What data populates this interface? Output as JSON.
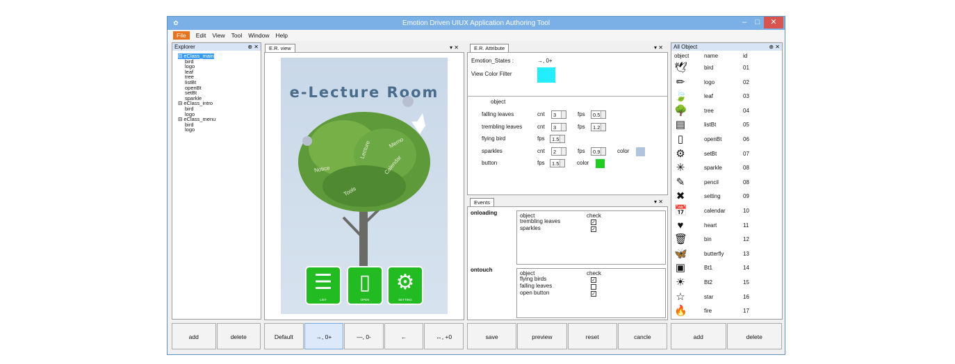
{
  "window": {
    "title": "Emotion Driven UIUX Application Authoring Tool",
    "min": "–",
    "max": "□",
    "close": "✕"
  },
  "menu": [
    "File",
    "Edit",
    "View",
    "Tool",
    "Window",
    "Help"
  ],
  "explorer": {
    "title": "Explorer",
    "pin": "⊕ ✕",
    "tree": [
      "⊟ eClass_main",
      "bird",
      "logo",
      "leaf",
      "tree",
      "listBt",
      "openBt",
      "setBt",
      "sparkle",
      "⊟ eClass_intro",
      "bird",
      "logo",
      "⊟ eClass_menu",
      "bird",
      "logo"
    ],
    "add": "add",
    "delete": "delete"
  },
  "erview": {
    "tab": "E.R. view",
    "ctrl": "▾ ✕",
    "title": "e-Lecture Room",
    "branches": [
      "Notice",
      "Tools",
      "Lecture",
      "Calendar",
      "Memo"
    ],
    "icons": [
      "LIST",
      "OPEN",
      "SETTING"
    ]
  },
  "erbuttons": [
    "Default",
    "→, 0+",
    "—, 0-",
    "←",
    "↔, +0"
  ],
  "attr": {
    "tab": "E.R. Attribute",
    "ctrl": "▾ ✕",
    "emotion_label": "Emotion_States :",
    "emotion_value": "→, 0+",
    "filter_label": "View Color Filter",
    "filter_color": "#22eeff",
    "object_header": "object",
    "rows": [
      {
        "name": "falling leaves",
        "a": "cnt",
        "av": "3",
        "b": "fps",
        "bv": "0.5"
      },
      {
        "name": "trembling leaves",
        "a": "cnt",
        "av": "3",
        "b": "fps",
        "bv": "1.2"
      },
      {
        "name": "flying bird",
        "a": "fps",
        "av": "1.5"
      },
      {
        "name": "sparkles",
        "a": "cnt",
        "av": "2",
        "b": "fps",
        "bv": "0.9",
        "c": "color",
        "color": "#b0c4de"
      },
      {
        "name": "button",
        "a": "fps",
        "av": "1.5",
        "c": "color",
        "color": "#22cc22"
      }
    ]
  },
  "events": {
    "tab": "Events",
    "ctrl": "▾ ✕",
    "onloading": "onloading",
    "ontouch": "ontouch",
    "col_object": "object",
    "col_check": "check",
    "load_items": [
      "trembling leaves",
      "sparkles"
    ],
    "touch_items": [
      "flying birds",
      "falling leaves",
      "open button"
    ],
    "touch_checked": [
      true,
      false,
      true
    ]
  },
  "actions": [
    "save",
    "preview",
    "reset",
    "cancle"
  ],
  "allobject": {
    "title": "All Object",
    "pin": "⊕ ✕",
    "headers": [
      "object",
      "name",
      "id"
    ],
    "items": [
      {
        "icon": "🕊",
        "name": "bird",
        "id": "01"
      },
      {
        "icon": "✏",
        "name": "logo",
        "id": "02"
      },
      {
        "icon": "🍃",
        "name": "leaf",
        "id": "03"
      },
      {
        "icon": "🌳",
        "name": "tree",
        "id": "04"
      },
      {
        "icon": "▤",
        "name": "listBt",
        "id": "05"
      },
      {
        "icon": "▯",
        "name": "openBt",
        "id": "06"
      },
      {
        "icon": "⚙",
        "name": "setBt",
        "id": "07"
      },
      {
        "icon": "✳",
        "name": "sparkle",
        "id": "08"
      },
      {
        "icon": "✎",
        "name": "pencil",
        "id": "08"
      },
      {
        "icon": "✖",
        "name": "setting",
        "id": "09"
      },
      {
        "icon": "📅",
        "name": "calendar",
        "id": "10"
      },
      {
        "icon": "♥",
        "name": "heart",
        "id": "11"
      },
      {
        "icon": "🗑",
        "name": "bin",
        "id": "12"
      },
      {
        "icon": "🦋",
        "name": "butterfly",
        "id": "13"
      },
      {
        "icon": "▣",
        "name": "Bt1",
        "id": "14"
      },
      {
        "icon": "☀",
        "name": "Bt2",
        "id": "15"
      },
      {
        "icon": "☆",
        "name": "star",
        "id": "16"
      },
      {
        "icon": "🔥",
        "name": "fire",
        "id": "17"
      }
    ],
    "add": "add",
    "delete": "delete"
  }
}
